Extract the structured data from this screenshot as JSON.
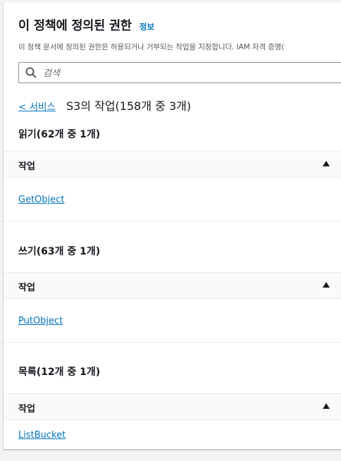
{
  "header": {
    "title": "이 정책에 정의된 권한",
    "info_link": "정보"
  },
  "description": "이 정책 문서에 정의된 권한은 허용되거나 거부되는 작업을 지정합니다. IAM 자격 증명(",
  "search": {
    "placeholder": "검색",
    "value": ""
  },
  "breadcrumb": {
    "back_link": "< 서비스",
    "context": "S3의 작업(158개 중 3개)"
  },
  "sections": [
    {
      "title": "읽기(62개 중 1개)",
      "column_header": "작업",
      "actions": [
        "GetObject"
      ]
    },
    {
      "title": "쓰기(63개 중 1개)",
      "column_header": "작업",
      "actions": [
        "PutObject"
      ]
    },
    {
      "title": "목록(12개 중 1개)",
      "column_header": "작업",
      "actions": [
        "ListBucket"
      ]
    }
  ],
  "icons": {
    "search": "search-icon",
    "sort": "sort-ascending-icon"
  },
  "colors": {
    "link": "#0073bb",
    "text": "#16191f",
    "muted": "#545b64",
    "background": "#f2f3f3",
    "panel": "#ffffff"
  }
}
